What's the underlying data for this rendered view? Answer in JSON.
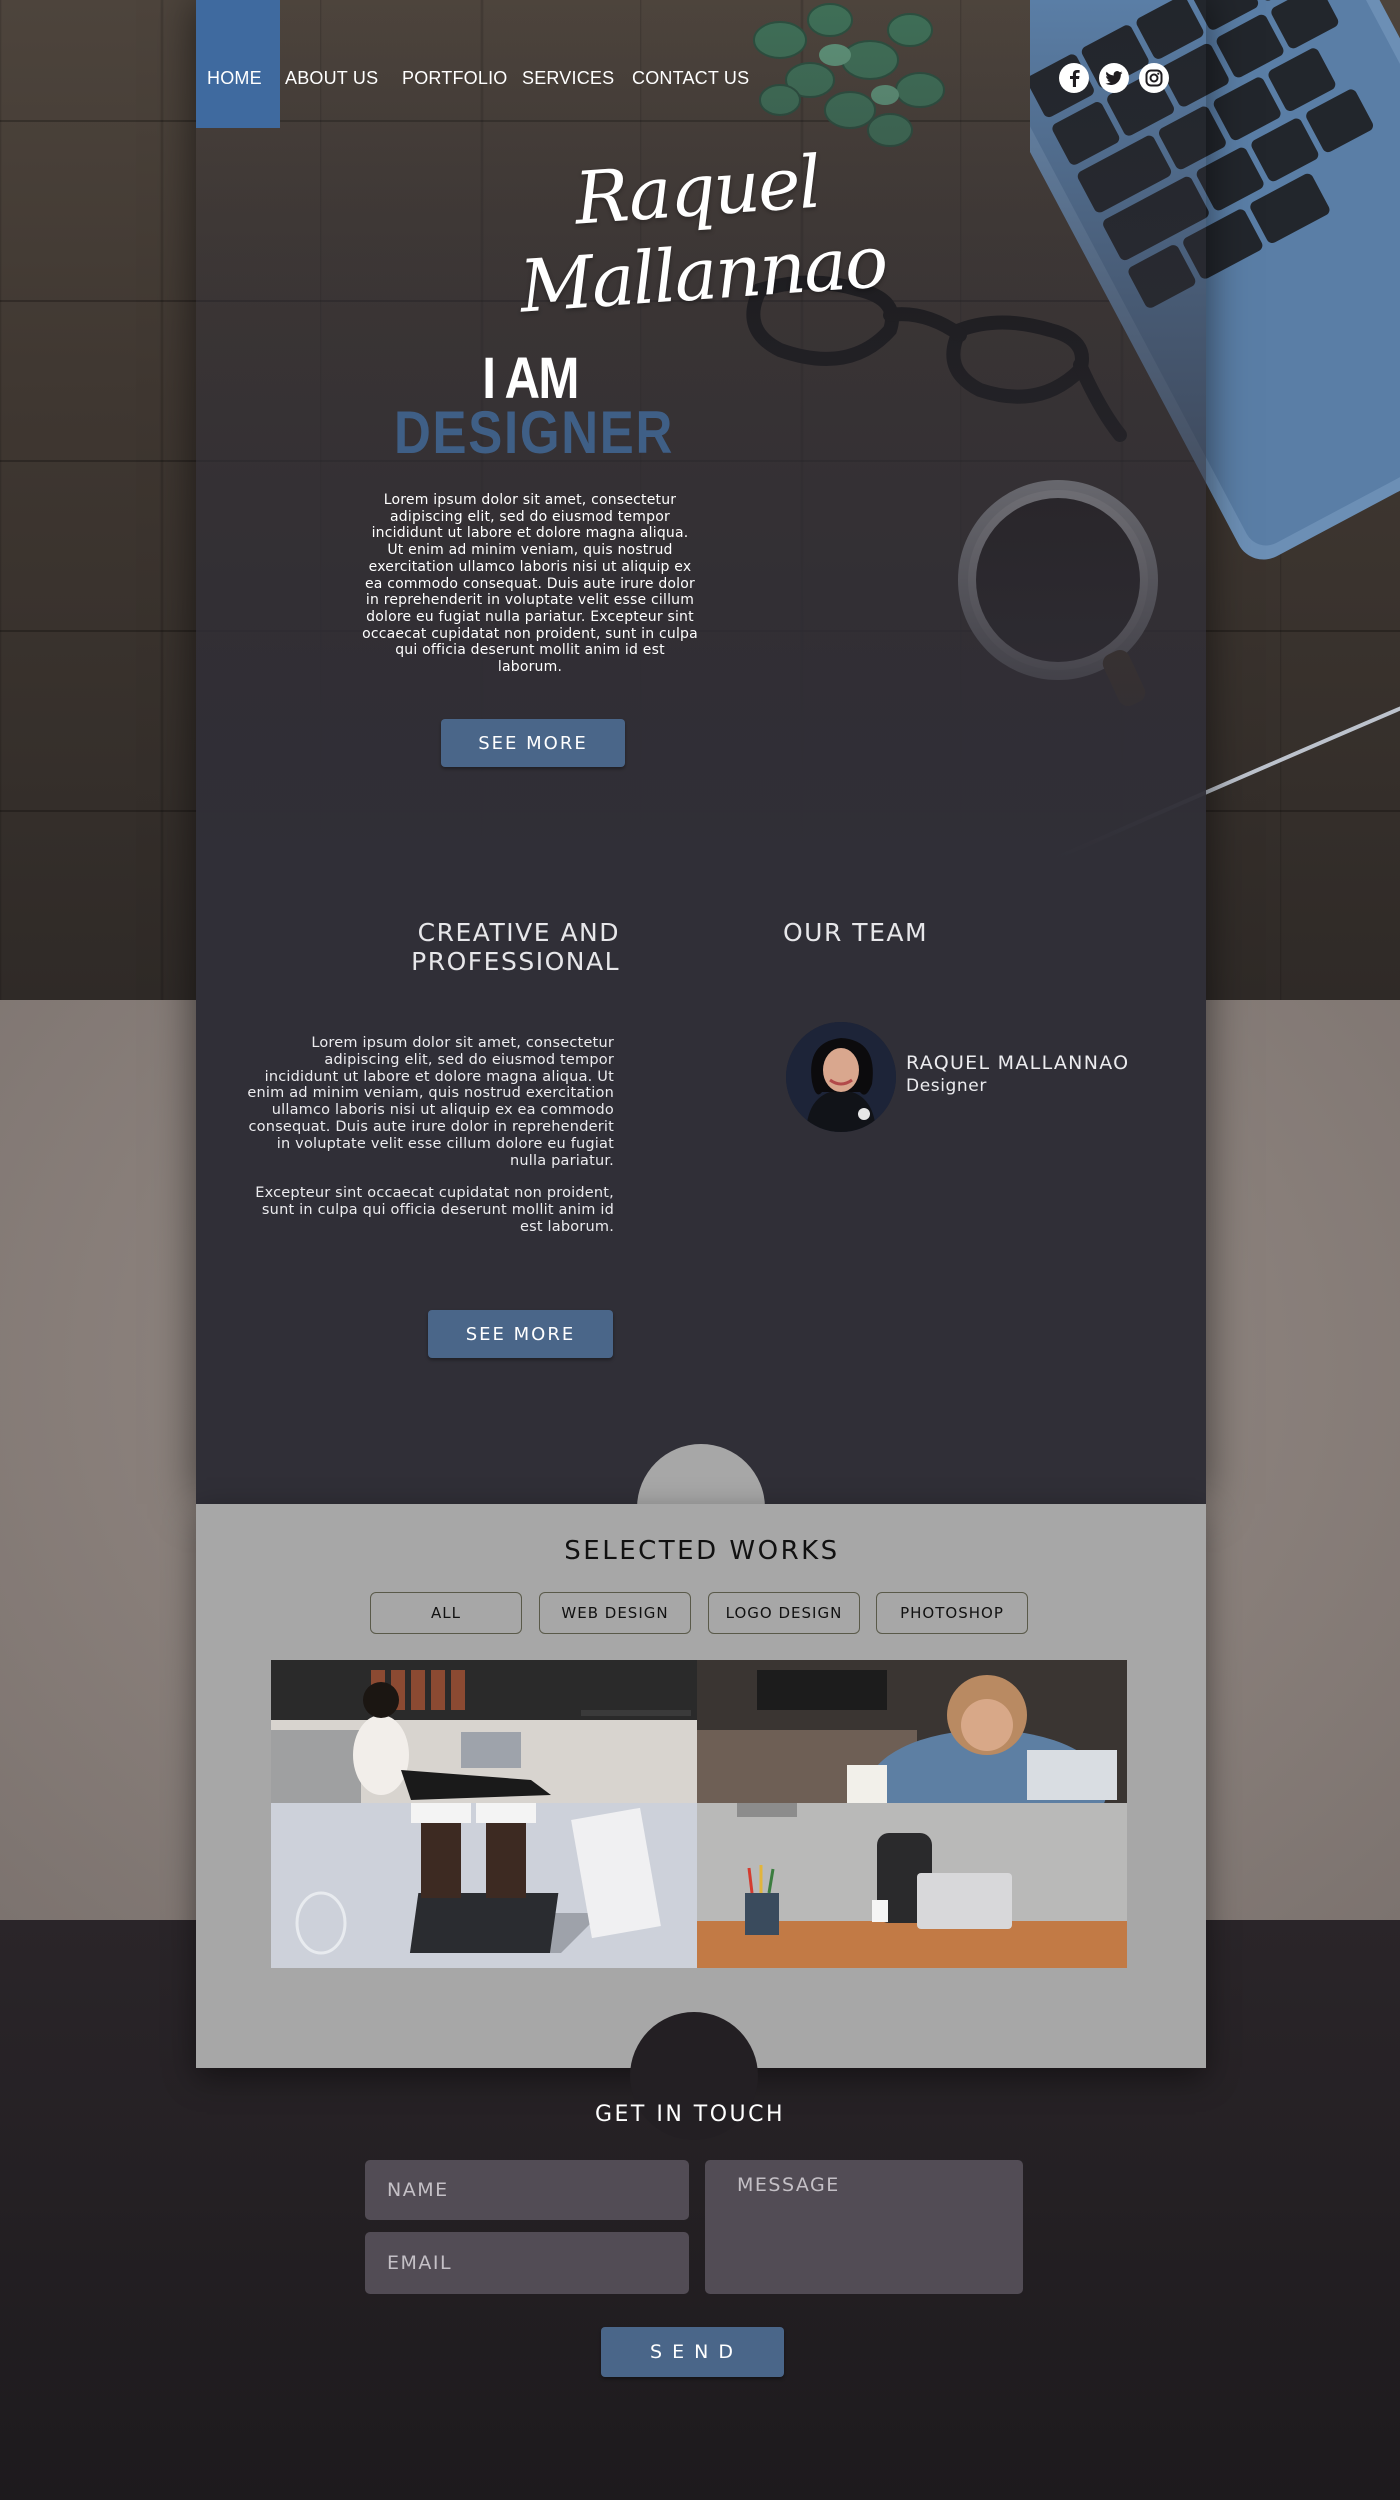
{
  "nav": {
    "items": [
      {
        "label": "HOME"
      },
      {
        "label": "ABOUT  US"
      },
      {
        "label": "PORTFOLIO"
      },
      {
        "label": "SERVICES"
      },
      {
        "label": "CONTACT US"
      }
    ],
    "active_index": 0,
    "social": [
      {
        "icon": "facebook-icon",
        "glyph": "f"
      },
      {
        "icon": "twitter-icon",
        "glyph": "t"
      },
      {
        "icon": "instagram-icon",
        "glyph": "ig"
      }
    ]
  },
  "hero": {
    "brand": "Raquel Mallannao",
    "headline_top": "I AM",
    "headline_bottom": "DESIGNER",
    "body": "Lorem ipsum dolor sit amet, consectetur adipiscing elit, sed do eiusmod tempor incididunt ut labore et dolore magna aliqua. Ut enim ad minim veniam, quis nostrud exercitation ullamco laboris nisi ut aliquip ex ea commodo consequat. Duis aute irure dolor in reprehenderit in voluptate velit esse cillum dolore eu fugiat nulla pariatur. Excepteur sint occaecat cupidatat non proident, sunt in culpa qui officia deserunt mollit anim id est laborum.",
    "button": "SEE MORE"
  },
  "creative": {
    "title": "CREATIVE AND PROFESSIONAL",
    "para1": "Lorem ipsum dolor sit amet, consectetur adipiscing elit, sed do eiusmod tempor incididunt ut labore et dolore magna aliqua. Ut enim ad minim veniam, quis nostrud exercitation ullamco laboris nisi ut aliquip ex ea commodo consequat. Duis aute irure dolor in reprehenderit in voluptate velit esse cillum dolore eu fugiat nulla pariatur.",
    "para2": "Excepteur sint occaecat cupidatat non proident, sunt in culpa qui officia deserunt mollit anim id est laborum.",
    "button": "SEE MORE"
  },
  "team": {
    "title": "OUR TEAM",
    "members": [
      {
        "name": "RAQUEL MALLANNAO",
        "role": "Designer"
      }
    ]
  },
  "works": {
    "title": "SELECTED WORKS",
    "filters": [
      "ALL",
      "WEB DESIGN",
      "LOGO DESIGN",
      "PHOTOSHOP"
    ]
  },
  "contact": {
    "title": "GET IN TOUCH",
    "name_placeholder": "NAME",
    "email_placeholder": "EMAIL",
    "message_placeholder": "MESSAGE",
    "button": "S E N D"
  },
  "colors": {
    "accent": "#3f6a9f",
    "button": "#4a6689",
    "panel": "#302f37",
    "works_bg": "#a7a7a7"
  }
}
